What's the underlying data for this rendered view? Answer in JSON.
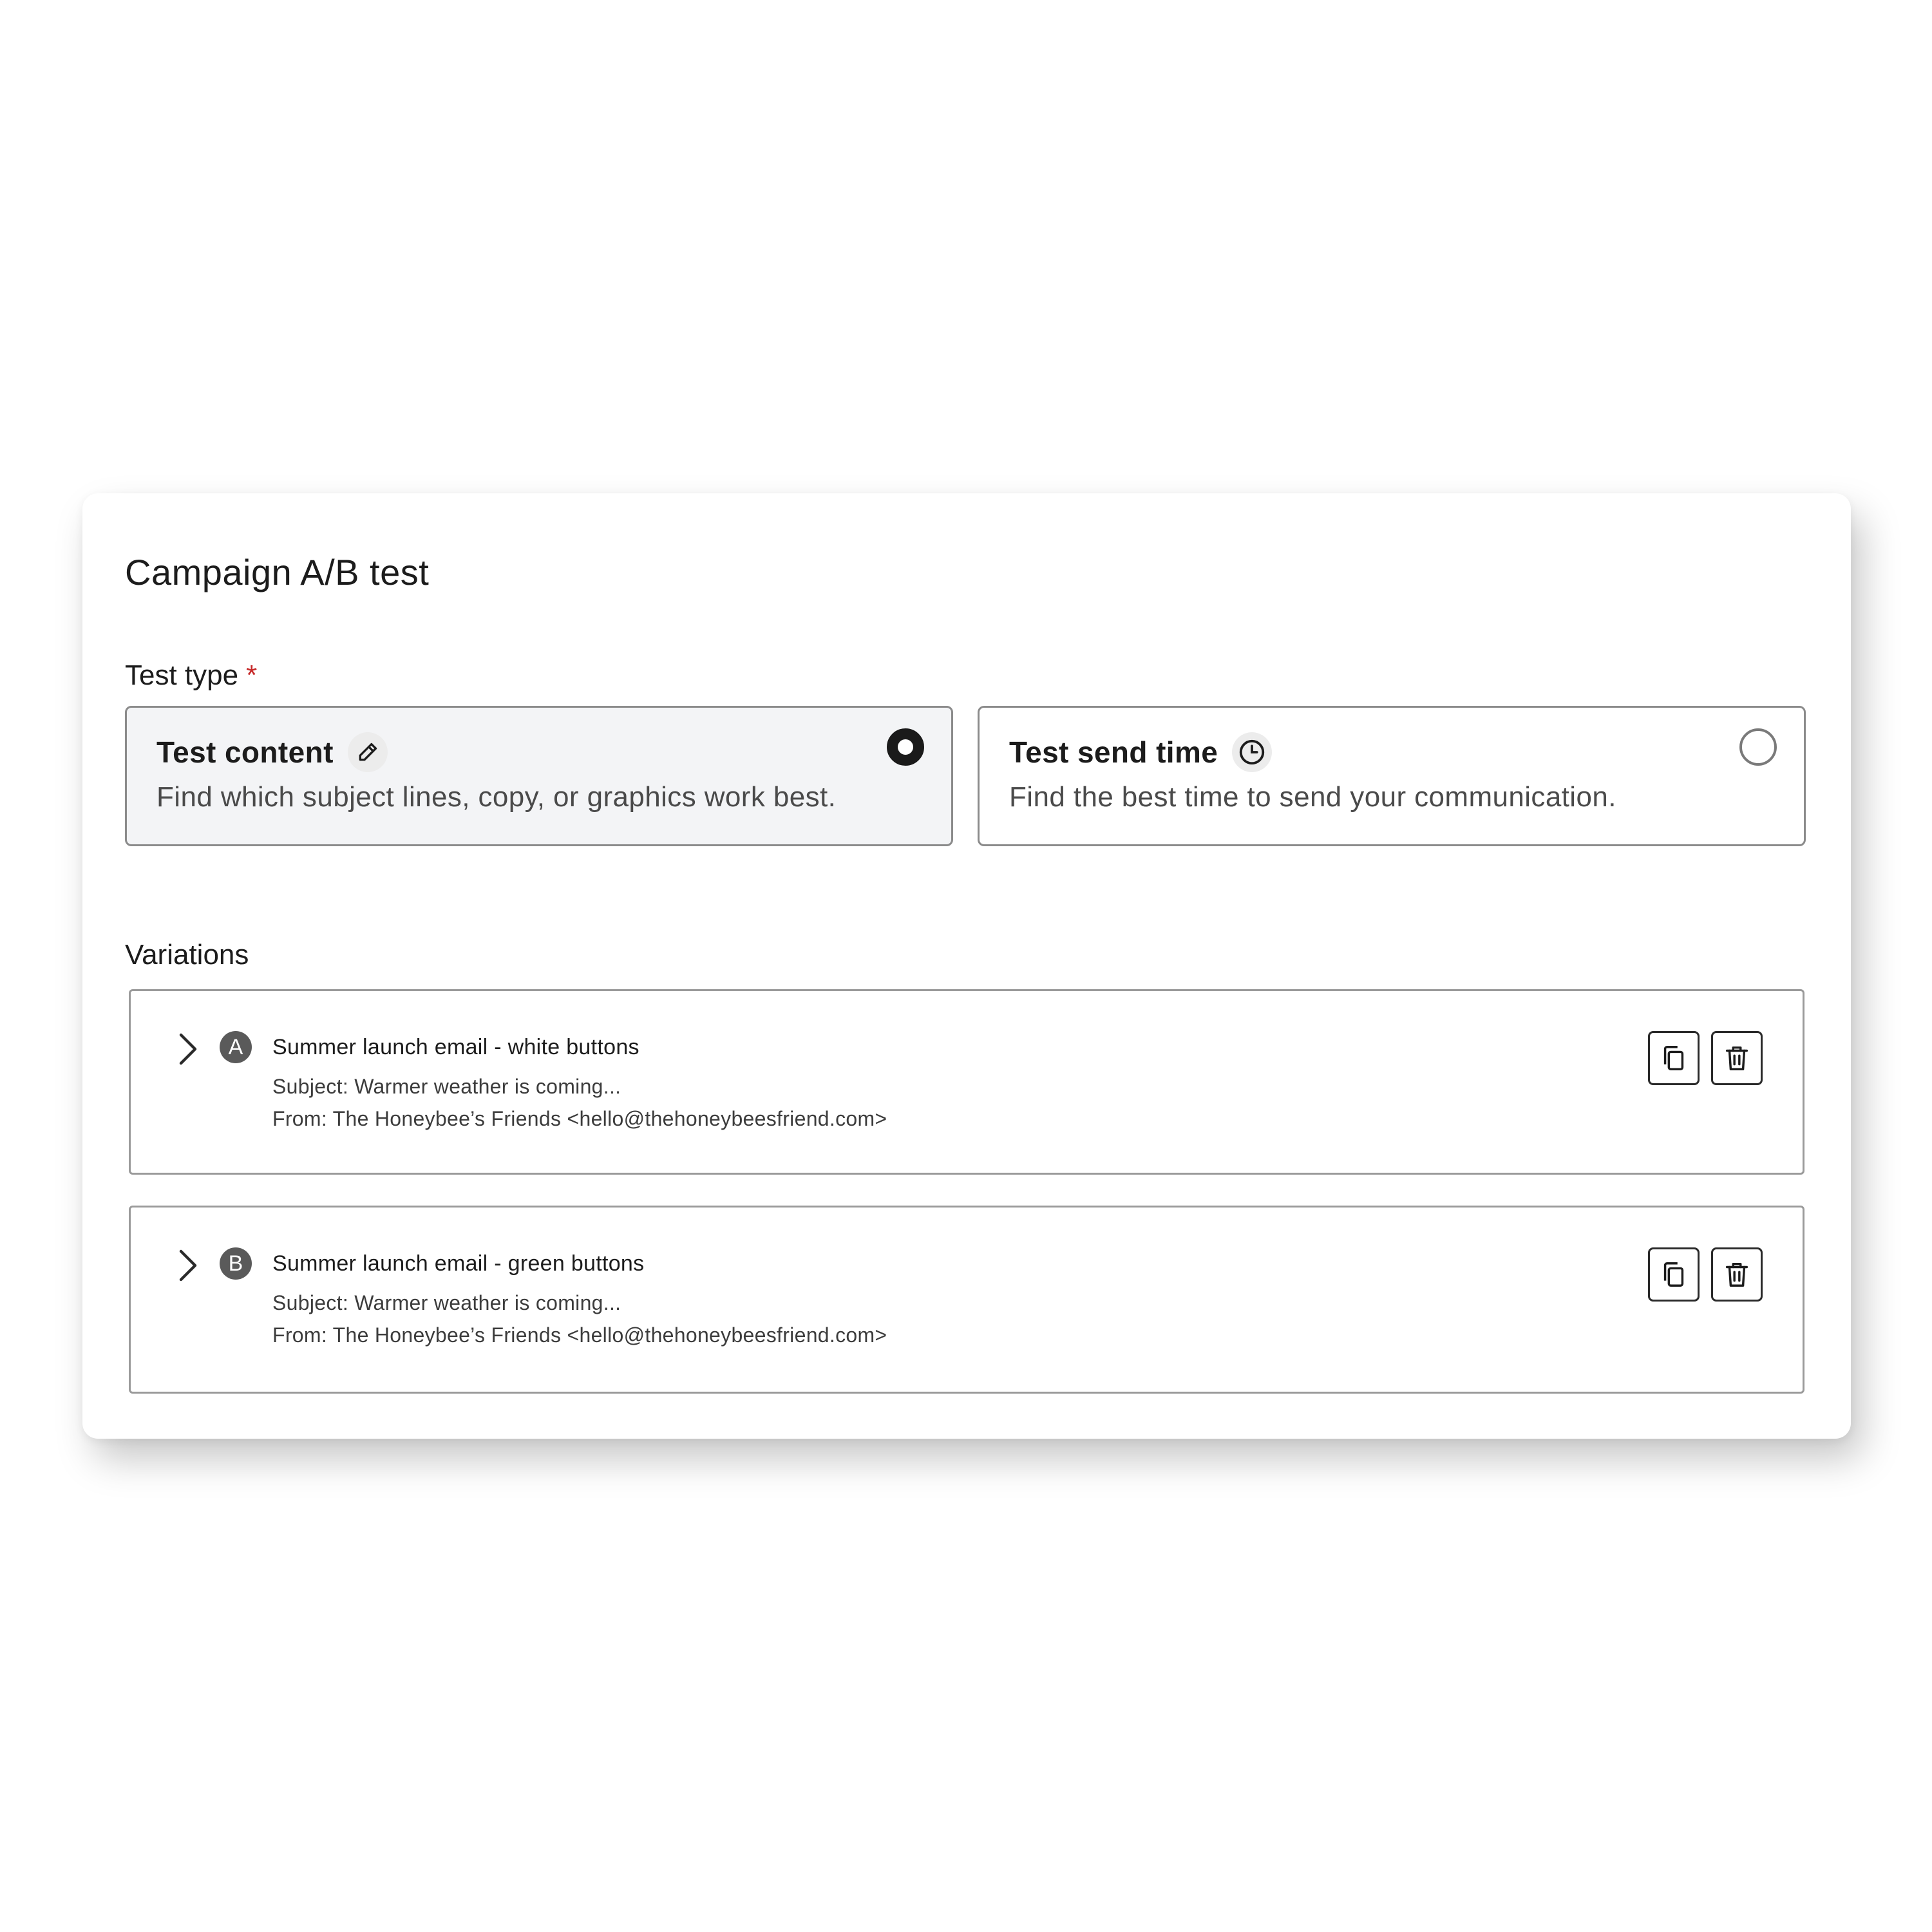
{
  "card": {
    "title": "Campaign A/B test"
  },
  "test_type": {
    "label": "Test type",
    "required_marker": "*",
    "options": [
      {
        "title": "Test content",
        "description": "Find which subject lines, copy, or graphics work best.",
        "icon": "pencil-icon",
        "selected": true
      },
      {
        "title": "Test send time",
        "description": "Find the best time to send your communication.",
        "icon": "clock-icon",
        "selected": false
      }
    ]
  },
  "variations": {
    "label": "Variations",
    "items": [
      {
        "badge": "A",
        "name": "Summer launch email - white buttons",
        "subject": "Subject: Warmer weather is coming...",
        "from": "From: The Honeybee’s Friends <hello@thehoneybeesfriend.com>"
      },
      {
        "badge": "B",
        "name": "Summer launch email - green buttons",
        "subject": "Subject: Warmer weather is coming...",
        "from": "From: The Honeybee’s Friends <hello@thehoneybeesfriend.com>"
      }
    ]
  },
  "icons": {
    "expand": "chevron-right-icon",
    "duplicate": "copy-icon",
    "delete": "trash-icon"
  },
  "colors": {
    "required": "#c62828",
    "selected_background": "#f3f4f6",
    "badge_background": "#5a5a5a"
  }
}
